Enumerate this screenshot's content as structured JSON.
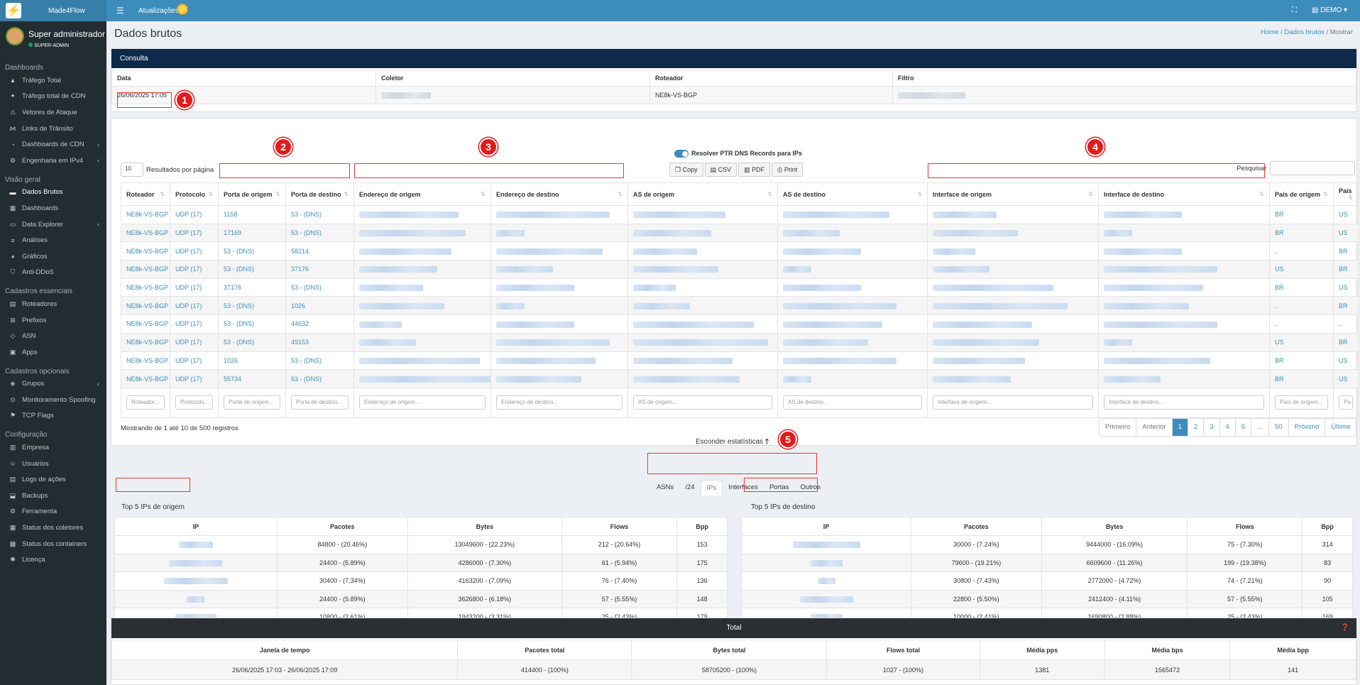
{
  "app": {
    "brand": "Made4Flow",
    "updates_label": "Atualizações",
    "user_menu": "DEMO"
  },
  "user": {
    "name": "Super administrador",
    "role": "SUPER-ADMIN"
  },
  "sidebar": {
    "sections": [
      {
        "title": "Dashboards",
        "items": [
          {
            "label": "Tráfego Total",
            "icon": "chart-area-icon"
          },
          {
            "label": "Tráfego total de CDN",
            "icon": "tower-icon"
          },
          {
            "label": "Vetores de Ataque",
            "icon": "warning-icon"
          },
          {
            "label": "Links de Trânsito",
            "icon": "network-icon"
          },
          {
            "label": "Dashboards de CDN",
            "icon": "dashboard-icon",
            "arrow": true
          },
          {
            "label": "Engenharia em IPv4",
            "icon": "cog-icon",
            "arrow": true
          }
        ]
      },
      {
        "title": "Visão geral",
        "items": [
          {
            "label": "Dados Brutos",
            "icon": "file-icon",
            "active": true
          },
          {
            "label": "Dashboards",
            "icon": "grid-icon"
          },
          {
            "label": "Data Explorer",
            "icon": "folder-icon",
            "arrow": true
          },
          {
            "label": "Análises",
            "icon": "list-icon"
          },
          {
            "label": "Gráficos",
            "icon": "pie-icon"
          },
          {
            "label": "Anti-DDoS",
            "icon": "shield-icon"
          }
        ]
      },
      {
        "title": "Cadastros essenciais",
        "items": [
          {
            "label": "Roteadores",
            "icon": "server-icon"
          },
          {
            "label": "Prefixos",
            "icon": "prefix-icon"
          },
          {
            "label": "ASN",
            "icon": "asn-icon"
          },
          {
            "label": "Apps",
            "icon": "apps-icon"
          }
        ]
      },
      {
        "title": "Cadastros opcionais",
        "items": [
          {
            "label": "Grupos",
            "icon": "layers-icon",
            "arrow": true
          },
          {
            "label": "Monitoramento Spoofing",
            "icon": "spoof-icon"
          },
          {
            "label": "TCP Flags",
            "icon": "flag-icon"
          }
        ]
      },
      {
        "title": "Configuração",
        "items": [
          {
            "label": "Empresa",
            "icon": "building-icon"
          },
          {
            "label": "Usuários",
            "icon": "users-icon"
          },
          {
            "label": "Logs de ações",
            "icon": "logs-icon"
          },
          {
            "label": "Backups",
            "icon": "backup-icon"
          },
          {
            "label": "Ferramenta",
            "icon": "tool-icon"
          },
          {
            "label": "Status dos coletores",
            "icon": "status-icon"
          },
          {
            "label": "Status dos containers",
            "icon": "container-icon"
          },
          {
            "label": "Licença",
            "icon": "license-icon"
          }
        ]
      }
    ]
  },
  "page": {
    "title": "Dados brutos",
    "breadcrumb": [
      "Home",
      "Dados brutos",
      "Mostrar"
    ]
  },
  "query": {
    "header": "Consulta",
    "col_date": "Data",
    "col_collector": "Coletor",
    "col_router": "Roteador",
    "col_filter": "Filtro",
    "date": "26/06/2025 17:05",
    "router": "NE8k-VS-BGP"
  },
  "table": {
    "page_size": "10",
    "page_size_label": "Resultados por página",
    "ptr_label": "Resolver PTR DNS Records para IPs",
    "buttons": [
      "Copy",
      "CSV",
      "PDF",
      "Print"
    ],
    "search_label": "Pesquisar",
    "headers": [
      "Roteador",
      "Protocolo",
      "Porta de origem",
      "Porta de destino",
      "Endereço de origem",
      "Endereço de destino",
      "AS de origem",
      "AS de destino",
      "Interface de origem",
      "Interface de destino",
      "País de origem",
      "País"
    ],
    "filters": [
      "Roteador...",
      "Protocolo...",
      "Porta de origem...",
      "Porta de destino...",
      "Endereço de origem...",
      "Endereço de destino...",
      "AS de origem...",
      "AS de destino...",
      "Interface de origem...",
      "Interface de destino...",
      "País de origem...",
      "Pa"
    ],
    "rows": [
      {
        "router": "NE8k-VS-BGP",
        "proto": "UDP (17)",
        "sport": "1158",
        "dport": "53 - (DNS)",
        "sc": "BR",
        "dc": "US"
      },
      {
        "router": "NE8k-VS-BGP",
        "proto": "UDP (17)",
        "sport": "17169",
        "dport": "53 - (DNS)",
        "sc": "BR",
        "dc": "US"
      },
      {
        "router": "NE8k-VS-BGP",
        "proto": "UDP (17)",
        "sport": "53 - (DNS)",
        "dport": "58214",
        "sc": "..",
        "dc": "BR"
      },
      {
        "router": "NE8k-VS-BGP",
        "proto": "UDP (17)",
        "sport": "53 - (DNS)",
        "dport": "37176",
        "sc": "US",
        "dc": "BR"
      },
      {
        "router": "NE8k-VS-BGP",
        "proto": "UDP (17)",
        "sport": "37176",
        "dport": "53 - (DNS)",
        "sc": "BR",
        "dc": "US"
      },
      {
        "router": "NE8k-VS-BGP",
        "proto": "UDP (17)",
        "sport": "53 - (DNS)",
        "dport": "1026",
        "sc": "..",
        "dc": "BR"
      },
      {
        "router": "NE8k-VS-BGP",
        "proto": "UDP (17)",
        "sport": "53 - (DNS)",
        "dport": "44632",
        "sc": "..",
        "dc": ".."
      },
      {
        "router": "NE8k-VS-BGP",
        "proto": "UDP (17)",
        "sport": "53 - (DNS)",
        "dport": "49153",
        "sc": "US",
        "dc": "BR"
      },
      {
        "router": "NE8k-VS-BGP",
        "proto": "UDP (17)",
        "sport": "1026",
        "dport": "53 - (DNS)",
        "sc": "BR",
        "dc": "US"
      },
      {
        "router": "NE8k-VS-BGP",
        "proto": "UDP (17)",
        "sport": "55734",
        "dport": "53 - (DNS)",
        "sc": "BR",
        "dc": "US"
      }
    ],
    "info": "Mostrando de 1 até 10 de 500 registros",
    "pagination": [
      "Primeiro",
      "Anterior",
      "1",
      "2",
      "3",
      "4",
      "5",
      "...",
      "50",
      "Próximo",
      "Último"
    ]
  },
  "stats": {
    "toggle_label": "Esconder estatísticas",
    "tabs": [
      "ASNs",
      "/24",
      "IPs",
      "Interfaces",
      "Portas",
      "Outros"
    ],
    "active_tab": "IPs",
    "src_title": "Top 5 IPs de origem",
    "dst_title": "Top 5 IPs de destino",
    "headers": [
      "IP",
      "Pacotes",
      "Bytes",
      "Flows",
      "Bpp"
    ],
    "src_rows": [
      [
        "84800 - (20.46%)",
        "13049600 - (22.23%)",
        "212 - (20.64%)",
        "153"
      ],
      [
        "24400 - (5.89%)",
        "4286000 - (7.30%)",
        "61 - (5.94%)",
        "175"
      ],
      [
        "30400 - (7.34%)",
        "4163200 - (7.09%)",
        "76 - (7.40%)",
        "136"
      ],
      [
        "24400 - (5.89%)",
        "3626800 - (6.18%)",
        "57 - (5.55%)",
        "148"
      ],
      [
        "10800 - (2.61%)",
        "1943200 - (3.31%)",
        "25 - (2.43%)",
        "179"
      ]
    ],
    "dst_rows": [
      [
        "30000 - (7.24%)",
        "9444000 - (16.09%)",
        "75 - (7.30%)",
        "314"
      ],
      [
        "79600 - (19.21%)",
        "6609600 - (11.26%)",
        "199 - (19.38%)",
        "83"
      ],
      [
        "30800 - (7.43%)",
        "2772000 - (4.72%)",
        "74 - (7.21%)",
        "90"
      ],
      [
        "22800 - (5.50%)",
        "2412400 - (4.11%)",
        "57 - (5.55%)",
        "105"
      ],
      [
        "10000 - (2.41%)",
        "1690800 - (2.88%)",
        "25 - (2.43%)",
        "169"
      ]
    ]
  },
  "total": {
    "title": "Total",
    "headers": [
      "Janela de tempo",
      "Pacotes total",
      "Bytes total",
      "Flows total",
      "Média pps",
      "Média bps",
      "Média bpp"
    ],
    "values": [
      "26/06/2025 17:03 - 26/06/2025 17:09",
      "414400 - (100%)",
      "58705200 - (100%)",
      "1027 - (100%)",
      "1381",
      "1565472",
      "141"
    ]
  },
  "annotations": [
    "1",
    "2",
    "3",
    "4",
    "5"
  ]
}
